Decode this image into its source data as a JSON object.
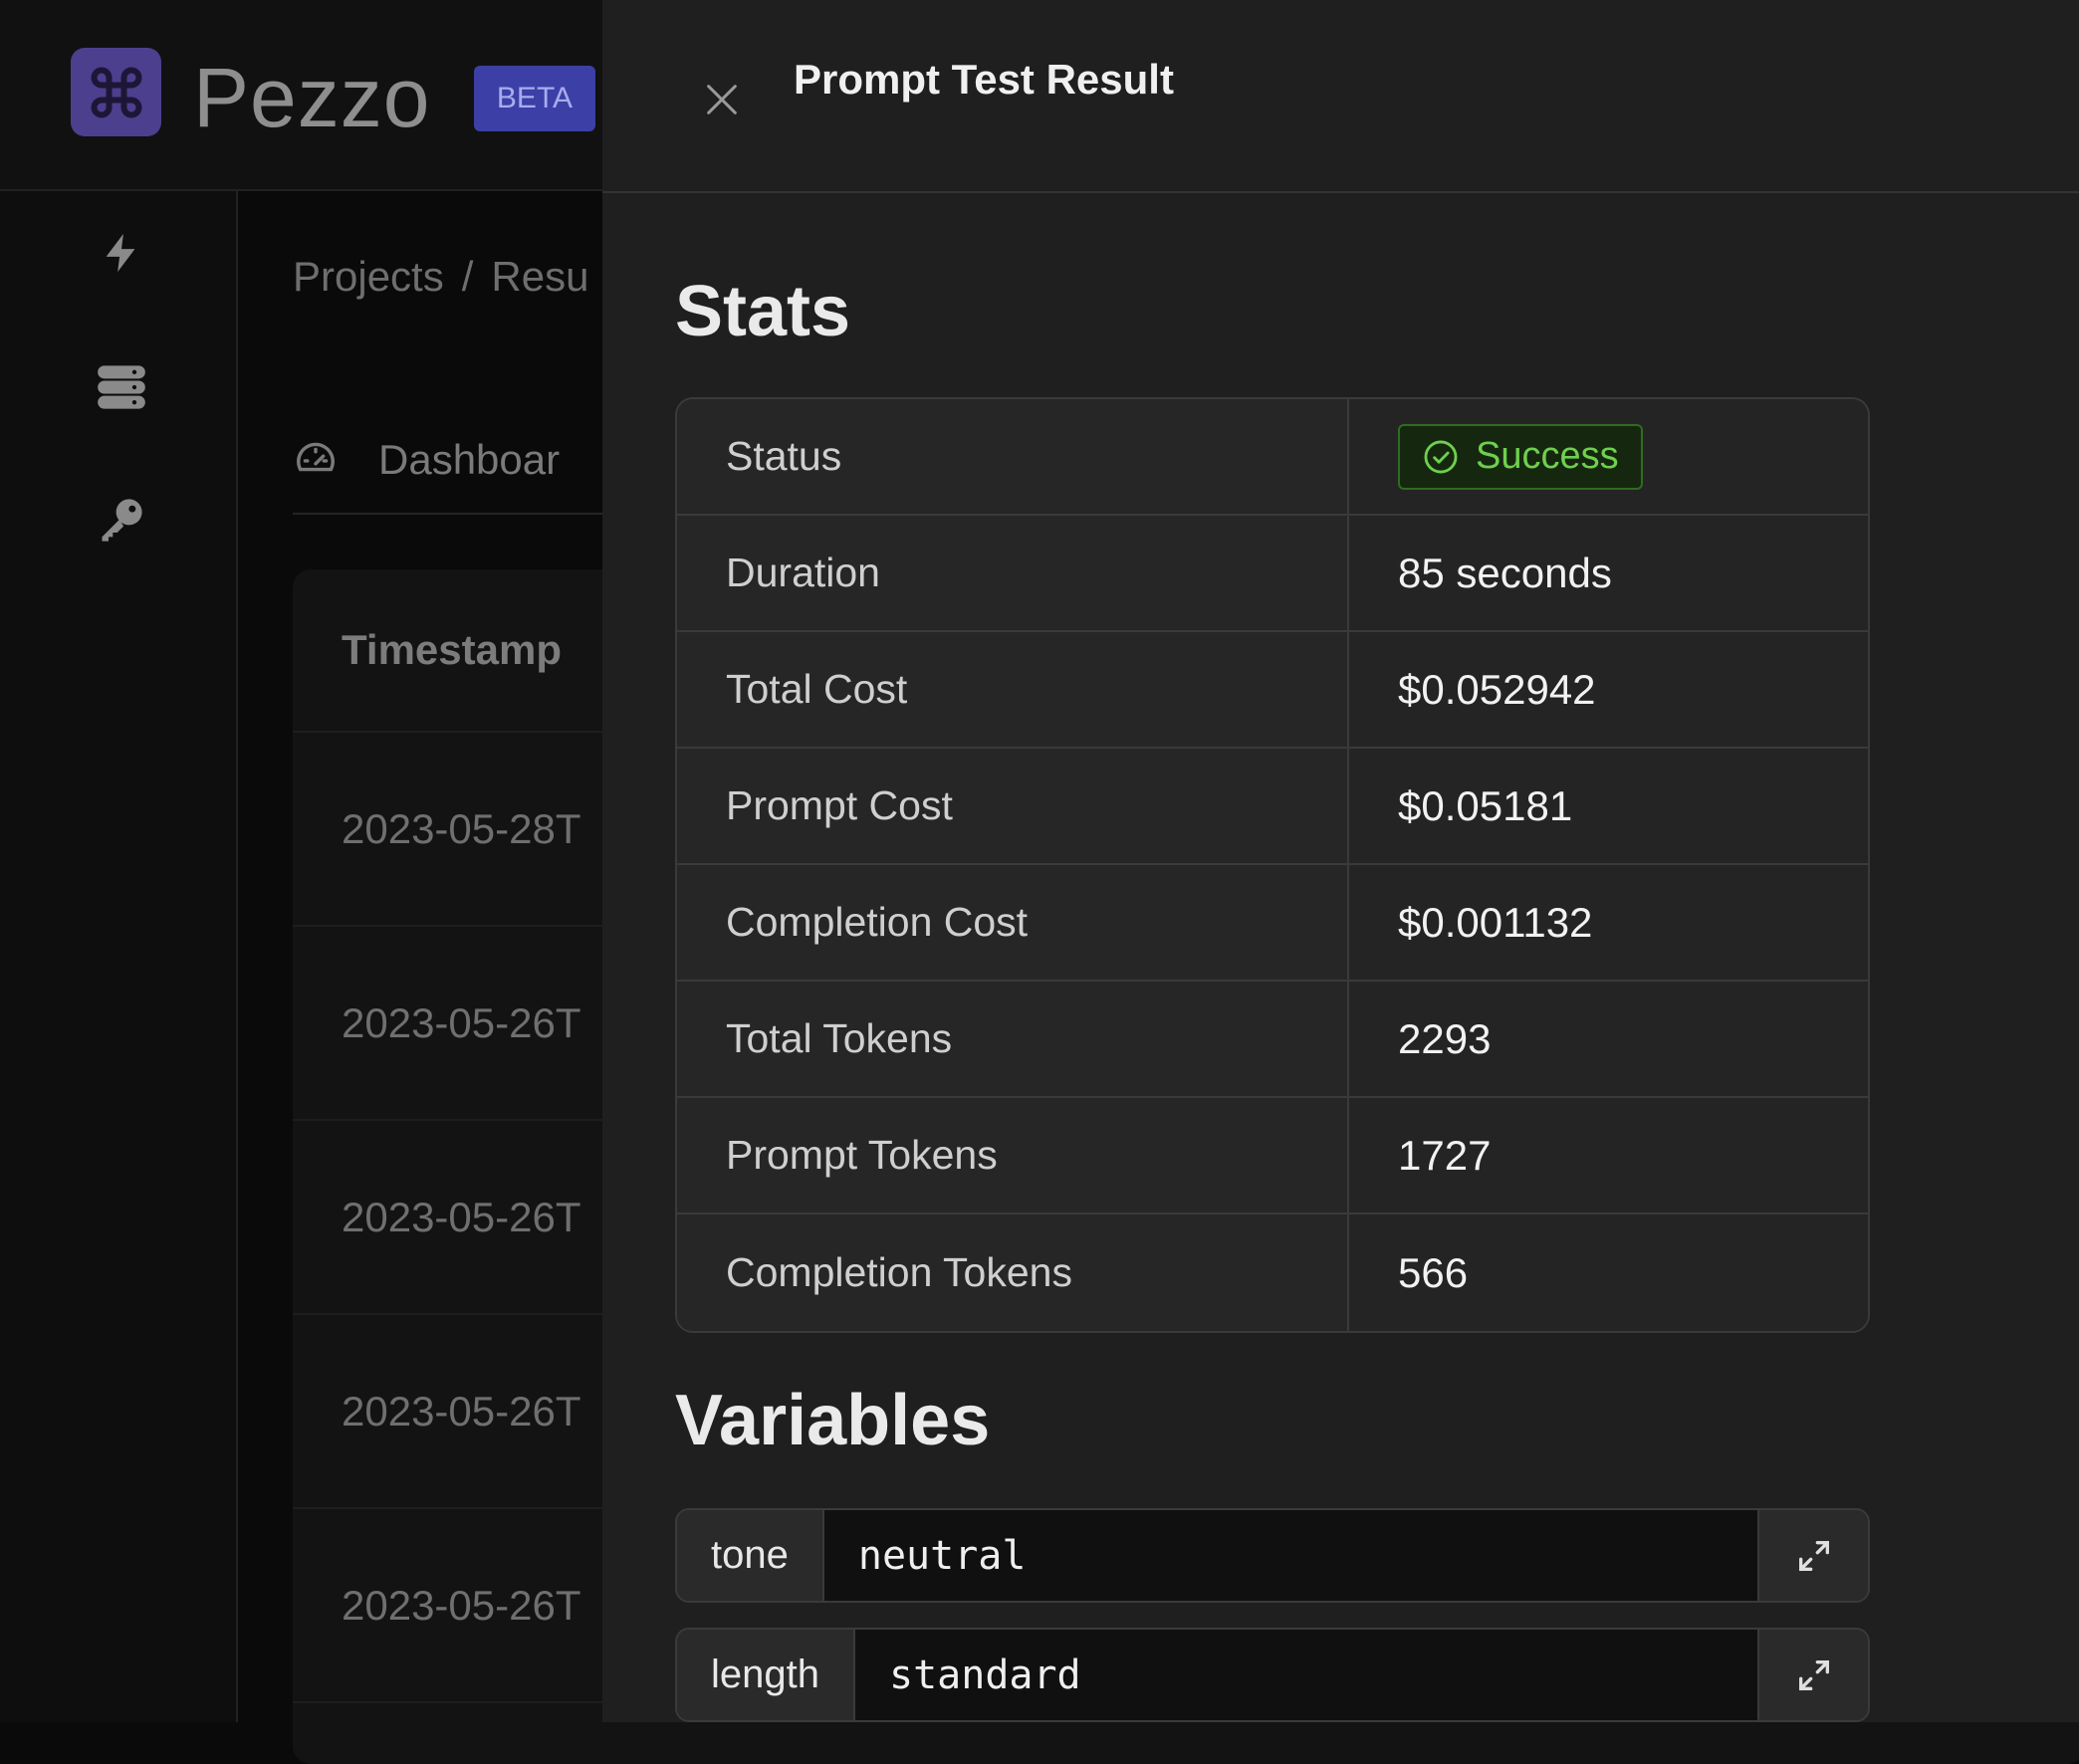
{
  "app": {
    "brand": "Pezzo",
    "beta_label": "BETA"
  },
  "breadcrumb": {
    "projects": "Projects",
    "separator": "/",
    "current": "Resu"
  },
  "tabs": {
    "dashboard": "Dashboar"
  },
  "results_table": {
    "header": "Timestamp",
    "rows": [
      "2023-05-28T",
      "2023-05-26T",
      "2023-05-26T",
      "2023-05-26T",
      "2023-05-26T"
    ]
  },
  "drawer": {
    "title": "Prompt Test Result",
    "stats_title": "Stats",
    "stats": [
      {
        "label": "Status",
        "value": "Success"
      },
      {
        "label": "Duration",
        "value": "85 seconds"
      },
      {
        "label": "Total Cost",
        "value": "$0.052942"
      },
      {
        "label": "Prompt Cost",
        "value": "$0.05181"
      },
      {
        "label": "Completion Cost",
        "value": "$0.001132"
      },
      {
        "label": "Total Tokens",
        "value": "2293"
      },
      {
        "label": "Prompt Tokens",
        "value": "1727"
      },
      {
        "label": "Completion Tokens",
        "value": "566"
      }
    ],
    "variables_title": "Variables",
    "variables": [
      {
        "key": "tone",
        "value": "neutral"
      },
      {
        "key": "length",
        "value": "standard"
      }
    ]
  },
  "icons": {
    "logo": "command-icon",
    "nav": [
      "lightning-icon",
      "database-icon",
      "key-icon"
    ],
    "dashboard": "gauge-icon",
    "close": "close-icon",
    "status": "check-circle-icon",
    "expand": "expand-icon"
  },
  "colors": {
    "brand": "#4c3f8e",
    "beta": "#3c3fa6",
    "success": "#6fcf4e",
    "drawer_bg": "#1f1f1f"
  }
}
